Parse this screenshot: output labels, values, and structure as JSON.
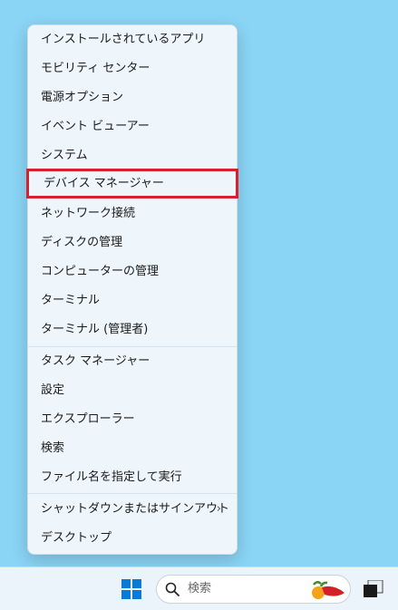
{
  "menu": {
    "items": [
      {
        "label": "インストールされているアプリ"
      },
      {
        "label": "モビリティ センター"
      },
      {
        "label": "電源オプション"
      },
      {
        "label": "イベント ビューアー"
      },
      {
        "label": "システム"
      },
      {
        "label": "デバイス マネージャー"
      },
      {
        "label": "ネットワーク接続"
      },
      {
        "label": "ディスクの管理"
      },
      {
        "label": "コンピューターの管理"
      },
      {
        "label": "ターミナル"
      },
      {
        "label": "ターミナル (管理者)"
      },
      {
        "label": "タスク マネージャー"
      },
      {
        "label": "設定"
      },
      {
        "label": "エクスプローラー"
      },
      {
        "label": "検索"
      },
      {
        "label": "ファイル名を指定して実行"
      },
      {
        "label": "シャットダウンまたはサインアウト",
        "chevron": "›"
      },
      {
        "label": "デスクトップ"
      }
    ]
  },
  "taskbar": {
    "search_placeholder": "検索",
    "start_icon": "windows-logo-icon",
    "search_icon": "search-icon",
    "highlight_icon": "chili-pepper-icon",
    "task_view_icon": "task-view-icon"
  },
  "colors": {
    "desktop": "#8ad4f5",
    "menu_bg": "#eef6fb",
    "highlight_border": "#d6202e",
    "windows_blue": "#0a7ad4"
  }
}
